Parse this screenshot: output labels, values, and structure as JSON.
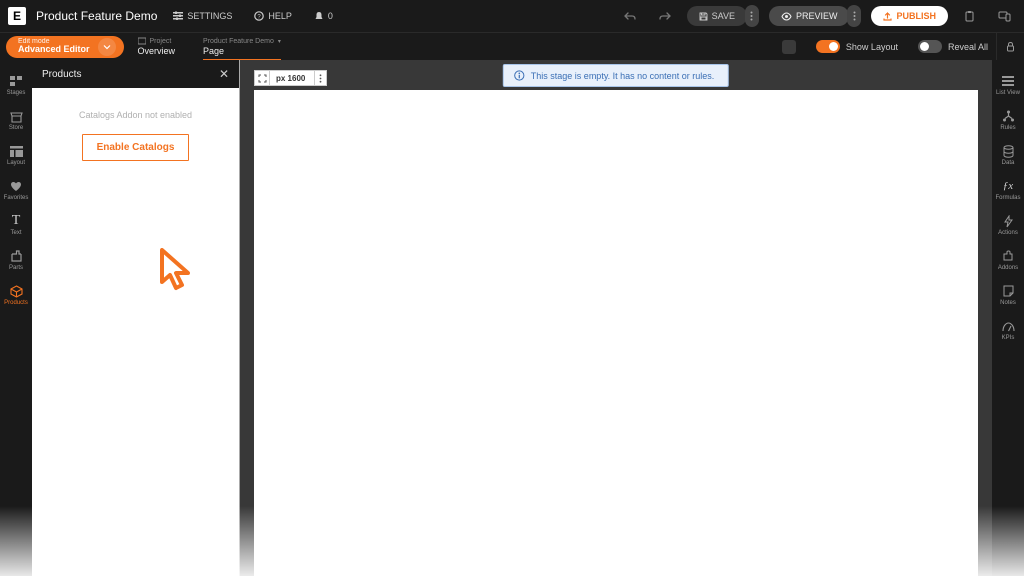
{
  "header": {
    "logo_letter": "E",
    "project_title": "Product Feature Demo",
    "settings": "SETTINGS",
    "help": "HELP",
    "notif_count": "0",
    "save": "SAVE",
    "preview": "PREVIEW",
    "publish": "PUBLISH"
  },
  "subheader": {
    "edit_mode_label": "Edit mode",
    "edit_mode_value": "Advanced Editor",
    "crumbs": [
      {
        "top": "Project",
        "bottom": "Overview"
      },
      {
        "top": "Product Feature Demo",
        "bottom": "Page"
      }
    ],
    "show_layout": "Show Layout",
    "reveal_all": "Reveal All"
  },
  "left_rail": [
    {
      "label": "Stages"
    },
    {
      "label": "Store"
    },
    {
      "label": "Layout"
    },
    {
      "label": "Favorites"
    },
    {
      "label": "Text"
    },
    {
      "label": "Parts"
    },
    {
      "label": "Products"
    }
  ],
  "right_rail": [
    {
      "label": "List View"
    },
    {
      "label": "Rules"
    },
    {
      "label": "Data"
    },
    {
      "label": "Formulas"
    },
    {
      "label": "Actions"
    },
    {
      "label": "Addons"
    },
    {
      "label": "Notes"
    },
    {
      "label": "KPIs"
    }
  ],
  "panel": {
    "title": "Products",
    "addon_text": "Catalogs Addon not enabled",
    "enable_button": "Enable Catalogs"
  },
  "canvas": {
    "px_label": "px 1600",
    "banner": "This stage is empty. It has no content or rules."
  }
}
